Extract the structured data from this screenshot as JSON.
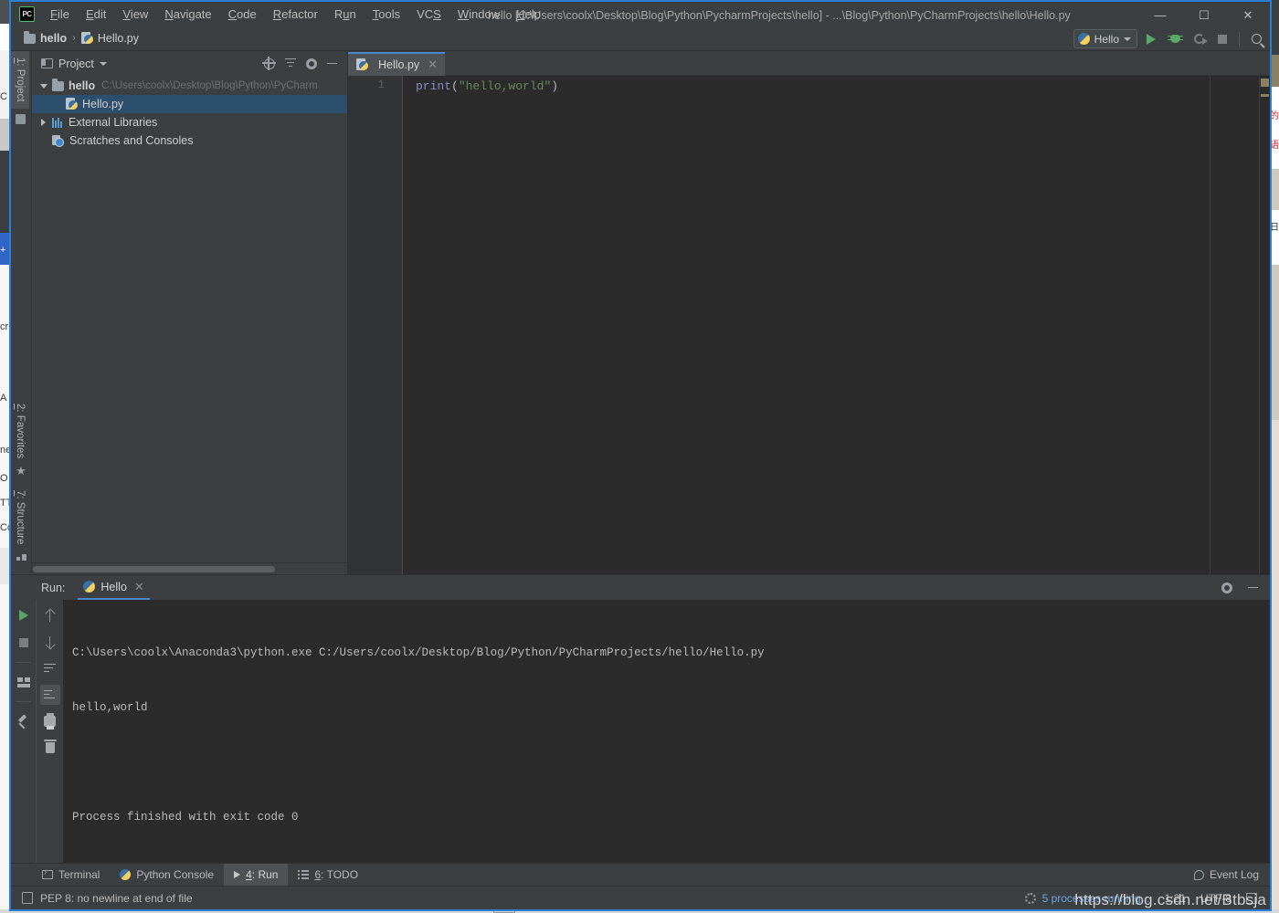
{
  "window": {
    "title": "hello [C:\\Users\\coolx\\Desktop\\Blog\\Python\\PycharmProjects\\hello] - ...\\Blog\\Python\\PyCharmProjects\\hello\\Hello.py",
    "app_logo": "pycharm-logo",
    "logo_text": "PC",
    "minimize": "—",
    "maximize": "☐",
    "close": "✕"
  },
  "menubar": {
    "items": [
      {
        "pre": "",
        "mn": "F",
        "post": "ile"
      },
      {
        "pre": "",
        "mn": "E",
        "post": "dit"
      },
      {
        "pre": "",
        "mn": "V",
        "post": "iew"
      },
      {
        "pre": "",
        "mn": "N",
        "post": "avigate"
      },
      {
        "pre": "",
        "mn": "C",
        "post": "ode"
      },
      {
        "pre": "",
        "mn": "R",
        "post": "efactor"
      },
      {
        "pre": "R",
        "mn": "u",
        "post": "n"
      },
      {
        "pre": "",
        "mn": "T",
        "post": "ools"
      },
      {
        "pre": "VC",
        "mn": "S",
        "post": ""
      },
      {
        "pre": "",
        "mn": "W",
        "post": "indow"
      },
      {
        "pre": "",
        "mn": "H",
        "post": "elp"
      }
    ]
  },
  "navbar": {
    "crumbs": [
      "hello",
      "Hello.py"
    ],
    "separator": "›",
    "run_config": "Hello",
    "icons": [
      "run-icon",
      "debug-icon",
      "coverage-icon",
      "stop-icon",
      "search-icon"
    ]
  },
  "left_tool_tabs": [
    {
      "label": "1: Project",
      "mn": "1",
      "rest": ": Project",
      "icon": "folder-icon",
      "active": true
    },
    {
      "label": "2: Favorites",
      "mn": "2",
      "rest": ": Favorites",
      "icon": "star-icon",
      "active": false
    },
    {
      "label": "7: Structure",
      "mn": "7",
      "rest": ": Structure",
      "icon": "structure-icon",
      "active": false
    }
  ],
  "project_pane": {
    "title": "Project",
    "header_icons": [
      "locate-target-icon",
      "collapse-all-icon",
      "gear-icon",
      "minimize-icon"
    ],
    "tree": [
      {
        "label": "hello",
        "path": "C:\\Users\\coolx\\Desktop\\Blog\\Python\\PyCharm",
        "icon": "folder-icon",
        "twisty": "down",
        "indent": 0,
        "bold": true,
        "selected": false
      },
      {
        "label": "Hello.py",
        "path": "",
        "icon": "python-file-icon",
        "twisty": "none",
        "indent": 1,
        "bold": false,
        "selected": true
      },
      {
        "label": "External Libraries",
        "path": "",
        "icon": "library-icon",
        "twisty": "right",
        "indent": 0,
        "bold": false,
        "selected": false
      },
      {
        "label": "Scratches and Consoles",
        "path": "",
        "icon": "scratches-icon",
        "twisty": "none",
        "indent": 0,
        "bold": false,
        "selected": false
      }
    ]
  },
  "editor": {
    "tabs": [
      {
        "label": "Hello.py",
        "icon": "python-file-icon",
        "close": "✕",
        "active": true
      }
    ],
    "line_numbers": [
      "1"
    ],
    "code_tokens": [
      {
        "text": "print",
        "cls": "k-fn"
      },
      {
        "text": "(",
        "cls": "k-pn"
      },
      {
        "text": "\"hello,world\"",
        "cls": "k-str"
      },
      {
        "text": ")",
        "cls": "k-pn"
      }
    ],
    "code_plain": "print(\"hello,world\")"
  },
  "run_pane": {
    "label": "Run:",
    "tab": "Hello",
    "tab_close": "✕",
    "header_icons": [
      "gear-icon",
      "minimize-icon"
    ],
    "toolbar_left": [
      "rerun-icon",
      "stop-icon",
      "layout-icon",
      "pin-icon"
    ],
    "toolbar_right": [
      "up-arrow-icon",
      "down-arrow-icon",
      "soft-wrap-icon",
      "scroll-to-end-icon",
      "print-icon",
      "trash-icon"
    ],
    "console_lines": [
      "C:\\Users\\coolx\\Anaconda3\\python.exe C:/Users/coolx/Desktop/Blog/Python/PyCharmProjects/hello/Hello.py",
      "hello,world",
      "",
      "Process finished with exit code 0"
    ]
  },
  "bottom_tabs": [
    {
      "mn": "",
      "pre": "Terminal",
      "post": "",
      "icon": "terminal-icon",
      "active": false
    },
    {
      "mn": "",
      "pre": "Python Console",
      "post": "",
      "icon": "python-console-icon",
      "active": false
    },
    {
      "mn": "4",
      "pre": "",
      "post": ": Run",
      "icon": "run-triangle-icon",
      "active": true
    },
    {
      "mn": "6",
      "pre": "",
      "post": ": TODO",
      "icon": "todo-icon",
      "active": false
    }
  ],
  "event_log": {
    "label": "Event Log",
    "icon": "event-log-icon"
  },
  "statusbar": {
    "message": "PEP 8: no newline at end of file",
    "message_icon": "inspection-icon",
    "processes": "5 processes running...",
    "caret_position": "1:21",
    "encoding": "UTF-8",
    "lock_icon": "read-only-lock-icon"
  },
  "watermark": "https://blog.csdn.net/Btbsja",
  "colors": {
    "accent_border": "#2a7fd4",
    "chrome": "#3c3f41",
    "editor_bg": "#2b2b2b",
    "selection": "#2d4f6e",
    "run_green": "#59a869",
    "string_green": "#6a8759",
    "keyword_purple": "#8888c6",
    "link_blue": "#6ba4dd",
    "tab_underline": "#4a88c7"
  },
  "background_left_glyphs": [
    "C",
    "A",
    "ne",
    "O",
    "TT",
    "Co",
    "cr",
    "+"
  ],
  "background_right_glyphs": [
    "的",
    "语"
  ]
}
